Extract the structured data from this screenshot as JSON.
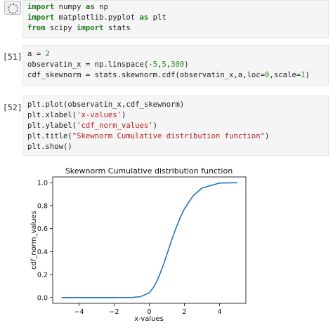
{
  "cells": {
    "cell1": {
      "prompt": "",
      "lines": [
        [
          "import",
          " numpy ",
          "as",
          " np"
        ],
        [
          "import",
          " matplotlib.pyplot ",
          "as",
          " plt"
        ],
        [
          "from",
          " scipy ",
          "import",
          " stats"
        ]
      ]
    },
    "cell2": {
      "prompt": "[51]",
      "line1_a": "a = ",
      "line1_b": "2",
      "line2_a": "observatin_x = np.linspace(-",
      "line2_b": "5",
      "line2_c": ",",
      "line2_d": "5",
      "line2_e": ",",
      "line2_f": "300",
      "line2_g": ")",
      "line3_a": "cdf_skewnorm = stats.skewnorm.cdf(observatin_x,a,loc=",
      "line3_b": "0",
      "line3_c": ",scale=",
      "line3_d": "1",
      "line3_e": ")"
    },
    "cell3": {
      "prompt": "[52]",
      "line1": "plt.plot(observatin_x,cdf_skewnorm)",
      "line2_a": "plt.xlabel(",
      "line2_b": "'x-values'",
      "line2_c": ")",
      "line3_a": "plt.ylabel(",
      "line3_b": "'cdf_norm_values'",
      "line3_c": ")",
      "line4_a": "plt.title(",
      "line4_b": "\"Skewnorm Cumulative distribution function\"",
      "line4_c": ")",
      "line5": "plt.show()"
    }
  },
  "colors": {
    "line": "#1f77b4",
    "code_bg": "#f5f5f5"
  },
  "chart_data": {
    "type": "line",
    "title": "Skewnorm Cumulative distribution function",
    "xlabel": "x-values",
    "ylabel": "cdf_norm_values",
    "xlim": [
      -5.5,
      5.5
    ],
    "ylim": [
      -0.05,
      1.05
    ],
    "xticks": [
      -4,
      -2,
      0,
      2,
      4
    ],
    "xtick_labels": [
      "−4",
      "−2",
      "0",
      "2",
      "4"
    ],
    "yticks": [
      0.0,
      0.2,
      0.4,
      0.6,
      0.8,
      1.0
    ],
    "ytick_labels": [
      "0.0",
      "0.2",
      "0.4",
      "0.6",
      "0.8",
      "1.0"
    ],
    "grid": false,
    "series": [
      {
        "x": [
          -5,
          -4,
          -3,
          -2,
          -1,
          -0.5,
          0,
          0.25,
          0.5,
          0.75,
          1,
          1.25,
          1.5,
          1.75,
          2,
          2.5,
          3,
          4,
          5
        ],
        "values": [
          0,
          0,
          0,
          0,
          0.001,
          0.008,
          0.042,
          0.09,
          0.165,
          0.262,
          0.374,
          0.489,
          0.597,
          0.691,
          0.773,
          0.886,
          0.953,
          0.997,
          1.0
        ]
      }
    ]
  }
}
